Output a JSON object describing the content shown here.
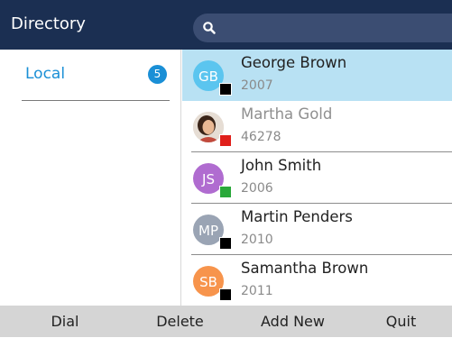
{
  "header": {
    "title": "Directory",
    "search_icon": "search-icon"
  },
  "left_pane": {
    "items": [
      {
        "label": "Local",
        "count": "5"
      }
    ]
  },
  "contacts": [
    {
      "initials": "GB",
      "name": "George Brown",
      "number": "2007",
      "avatar_color": "#5bc5ef",
      "status_color": "#000000",
      "selected": true
    },
    {
      "initials": "",
      "name": "Martha Gold",
      "number": "46278",
      "avatar_color": "#c9a27e",
      "status_color": "#e0201b",
      "photo": true
    },
    {
      "initials": "JS",
      "name": "John Smith",
      "number": "2006",
      "avatar_color": "#b06cd0",
      "status_color": "#2aa83a"
    },
    {
      "initials": "MP",
      "name": "Martin Penders",
      "number": "2010",
      "avatar_color": "#9aa4b4",
      "status_color": "#000000"
    },
    {
      "initials": "SB",
      "name": "Samantha Brown",
      "number": "2011",
      "avatar_color": "#f7944c",
      "status_color": "#000000"
    }
  ],
  "softkeys": {
    "dial": "Dial",
    "delete": "Delete",
    "add_new": "Add New",
    "quit": "Quit"
  },
  "colors": {
    "header_bg": "#1b2f52",
    "accent": "#1a8fd6",
    "selected_row": "#b8e1f3",
    "softkey_bar": "#d5d5d5"
  }
}
